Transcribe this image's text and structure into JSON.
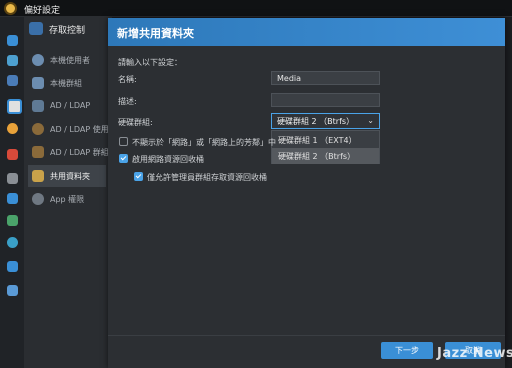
{
  "window": {
    "title": "偏好設定"
  },
  "sidebar": {
    "header": "存取控制",
    "items": [
      {
        "label": "本機使用者",
        "icon": "user-icon"
      },
      {
        "label": "本機群組",
        "icon": "group-icon"
      },
      {
        "label": "AD / LDAP",
        "icon": "directory-icon"
      },
      {
        "label": "AD / LDAP 使用者",
        "icon": "directory-user-icon"
      },
      {
        "label": "AD / LDAP 群組",
        "icon": "directory-group-icon"
      },
      {
        "label": "共用資料夾",
        "icon": "folder-icon"
      },
      {
        "label": "App 權限",
        "icon": "app-permission-icon"
      }
    ],
    "active_index": 5
  },
  "dialog": {
    "title": "新增共用資料夾",
    "intro": "請輸入以下設定：",
    "name_label": "名稱:",
    "name_value": "Media",
    "description_label": "描述:",
    "description_value": "",
    "volume_label": "硬碟群組:",
    "volume_selected": "硬碟群組 2 （Btrfs）",
    "volume_options": [
      "硬碟群組 1 （EXT4）",
      "硬碟群組 2 （Btrfs）"
    ],
    "checkbox_hide": {
      "label": "不顯示於「網路」或「網路上的芳鄰」中",
      "checked": false
    },
    "checkbox_recycle": {
      "label": "啟用網路資源回收桶",
      "checked": true
    },
    "checkbox_admin_only": {
      "label": "僅允許管理員群組存取資源回收桶",
      "checked": true
    },
    "next_label": "下一步",
    "cancel_label": "取消"
  },
  "watermark": "Jazz News",
  "colors": {
    "accent": "#3a8fd6",
    "title_bar": "#2d78b9",
    "background": "#2c2f33"
  }
}
